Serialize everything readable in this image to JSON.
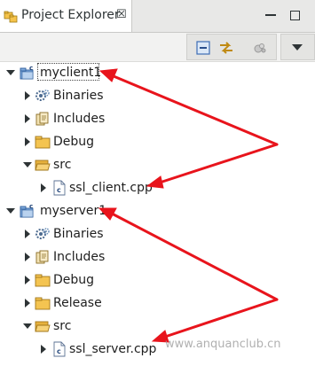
{
  "view": {
    "title": "Project Explorer",
    "close_glyph": "☒",
    "icon": "project-explorer-icon"
  },
  "toolbar": {
    "collapse_all": "collapse-all-icon",
    "link_with_editor": "link-with-editor-icon",
    "filter": "filter-icon",
    "view_menu": "view-menu-icon"
  },
  "tree": {
    "projects": [
      {
        "name": "myclient1",
        "expanded": true,
        "children": [
          {
            "label": "Binaries",
            "icon": "binaries-icon",
            "expanded": false
          },
          {
            "label": "Includes",
            "icon": "includes-icon",
            "expanded": false
          },
          {
            "label": "Debug",
            "icon": "folder-icon",
            "expanded": false
          },
          {
            "label": "src",
            "icon": "folder-open-icon",
            "expanded": true,
            "children": [
              {
                "label": "ssl_client.cpp",
                "icon": "cpp-file-icon"
              }
            ]
          }
        ]
      },
      {
        "name": "myserver1",
        "expanded": true,
        "children": [
          {
            "label": "Binaries",
            "icon": "binaries-icon",
            "expanded": false
          },
          {
            "label": "Includes",
            "icon": "includes-icon",
            "expanded": false
          },
          {
            "label": "Debug",
            "icon": "folder-icon",
            "expanded": false
          },
          {
            "label": "Release",
            "icon": "folder-icon",
            "expanded": false
          },
          {
            "label": "src",
            "icon": "folder-open-icon",
            "expanded": true,
            "children": [
              {
                "label": "ssl_server.cpp",
                "icon": "cpp-file-icon"
              }
            ]
          }
        ]
      }
    ]
  },
  "annotations": {
    "arrow_color": "#e8141c"
  },
  "watermark": "www.anquanclub.cn"
}
